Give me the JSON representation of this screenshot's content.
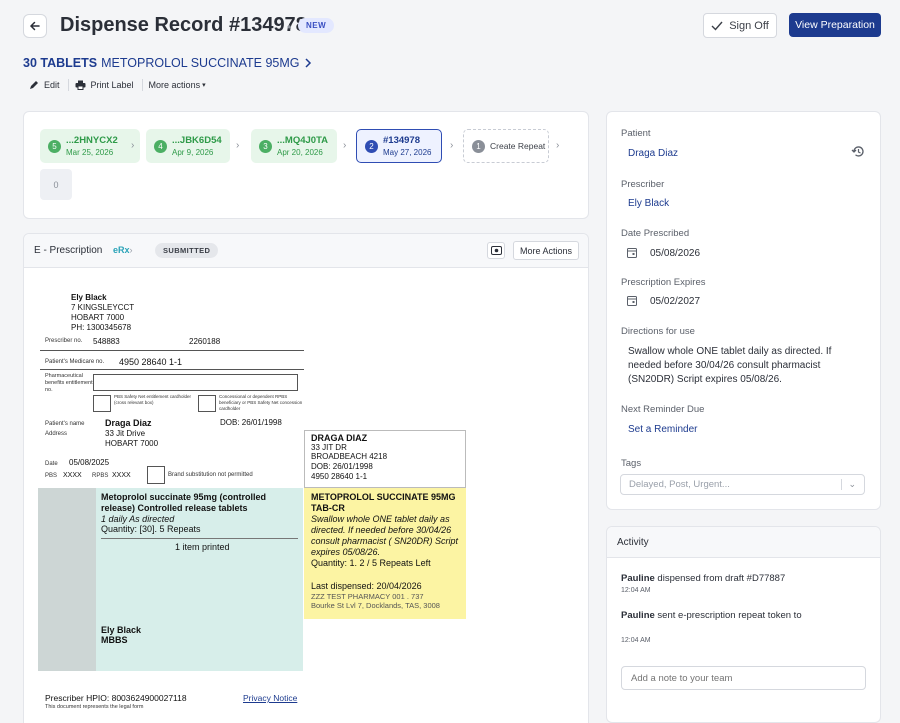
{
  "header": {
    "title": "Dispense Record #134978",
    "badge": "NEW",
    "sign_off": "Sign Off",
    "view_preparation": "View Preparation"
  },
  "drug": {
    "qty": "30 TABLETS",
    "name": "METOPROLOL SUCCINATE 95MG"
  },
  "toolbar": {
    "edit": "Edit",
    "print_label": "Print Label",
    "more_actions": "More actions"
  },
  "steps": [
    {
      "num": "5",
      "code": "...2HNYCX2",
      "date": "Mar 25, 2026"
    },
    {
      "num": "4",
      "code": "...JBK6D54",
      "date": "Apr 9, 2026"
    },
    {
      "num": "3",
      "code": "...MQ4J0TA",
      "date": "Apr 20, 2026"
    },
    {
      "num": "2",
      "code": "#134978",
      "date": "May 27, 2026"
    },
    {
      "num": "1",
      "label": "Create Repeat"
    }
  ],
  "zero_badge": "0",
  "prescription": {
    "title": "E - Prescription",
    "erx": "eRx",
    "status": "SUBMITTED",
    "more_actions": "More Actions",
    "prescriber_name": "Ely Black",
    "prescriber_addr1": "7 KINGSLEYCCT",
    "prescriber_addr2": "HOBART 7000",
    "prescriber_ph": "PH: 1300345678",
    "prescriber_no_label": "Prescriber no.",
    "prescriber_no": "548883",
    "prescriber_no2": "2260188",
    "medicare_label": "Patient's Medicare no.",
    "medicare_no": "4950 28640 1-1",
    "pbe_label": "Pharmaceutical benefits entitlement no.",
    "pbs_safety": "PBS Safety Net entitlement cardholder (cross relevant box)",
    "concessional": "Concessional or dependent RPBS beneficiary or PBS Safety Net concession cardholder",
    "patient_name_label": "Patient's name",
    "address_label": "Address",
    "patient_name": "Draga Diaz",
    "patient_addr1": "33 Jit Drive",
    "patient_addr2": "HOBART 7000",
    "dob": "DOB: 26/01/1998",
    "date_label": "Date",
    "date": "05/08/2025",
    "pbs_label": "PBS",
    "pbs_val": "XXXX",
    "rpbs_label": "RPBS",
    "rpbs_val": "XXXX",
    "brand_sub": "Brand substitution not permitted",
    "med_name": "Metoprolol succinate 95mg (controlled release) Controlled release tablets",
    "med_dose": "1 daily As directed",
    "med_qty": "Quantity: [30]. 5 Repeats",
    "items_printed": "1 item printed",
    "sig_name": "Ely Black",
    "sig_qual": "MBBS",
    "hpio": "Prescriber HPIO: 8003624900027118",
    "legal": "This document represents the legal form",
    "privacy": "Privacy Notice",
    "pt_box_name": "DRAGA DIAZ",
    "pt_box_addr1": "33 JIT DR",
    "pt_box_addr2": "BROADBEACH 4218",
    "pt_box_dob": "DOB: 26/01/1998",
    "pt_box_ph": "4950 28640 1-1",
    "label_drug": "METOPROLOL SUCCINATE 95MG TAB-CR",
    "label_directions": "Swallow whole ONE tablet daily as directed. If needed before 30/04/26 consult pharmacist ( SN20DR) Script expires 05/08/26.",
    "label_qty": "Quantity: 1. 2 / 5 Repeats Left",
    "label_last": "Last dispensed: 20/04/2026",
    "label_pharmacy": "ZZZ TEST PHARMACY  001 .  737",
    "label_pharmacy_addr": "Bourke St Lvl 7, Docklands, TAS, 3008"
  },
  "details": {
    "patient_label": "Patient",
    "patient": "Draga Diaz",
    "prescriber_label": "Prescriber",
    "prescriber": "Ely Black",
    "date_prescribed_label": "Date Prescribed",
    "date_prescribed": "05/08/2026",
    "expires_label": "Prescription Expires",
    "expires": "05/02/2027",
    "directions_label": "Directions for use",
    "directions": "Swallow whole ONE tablet daily as directed. If needed before 30/04/26 consult pharmacist (SN20DR) Script expires 05/08/26.",
    "reminder_label": "Next Reminder Due",
    "reminder_link": "Set a Reminder",
    "tags_label": "Tags",
    "tags_placeholder": "Delayed, Post, Urgent..."
  },
  "activity": {
    "title": "Activity",
    "entries": [
      {
        "user": "Pauline",
        "text": " dispensed from draft #D77887",
        "time": "12:04 AM"
      },
      {
        "user": "Pauline",
        "text": " sent e-prescription repeat token to",
        "time": "12:04 AM"
      }
    ],
    "note_placeholder": "Add a note to your team"
  }
}
